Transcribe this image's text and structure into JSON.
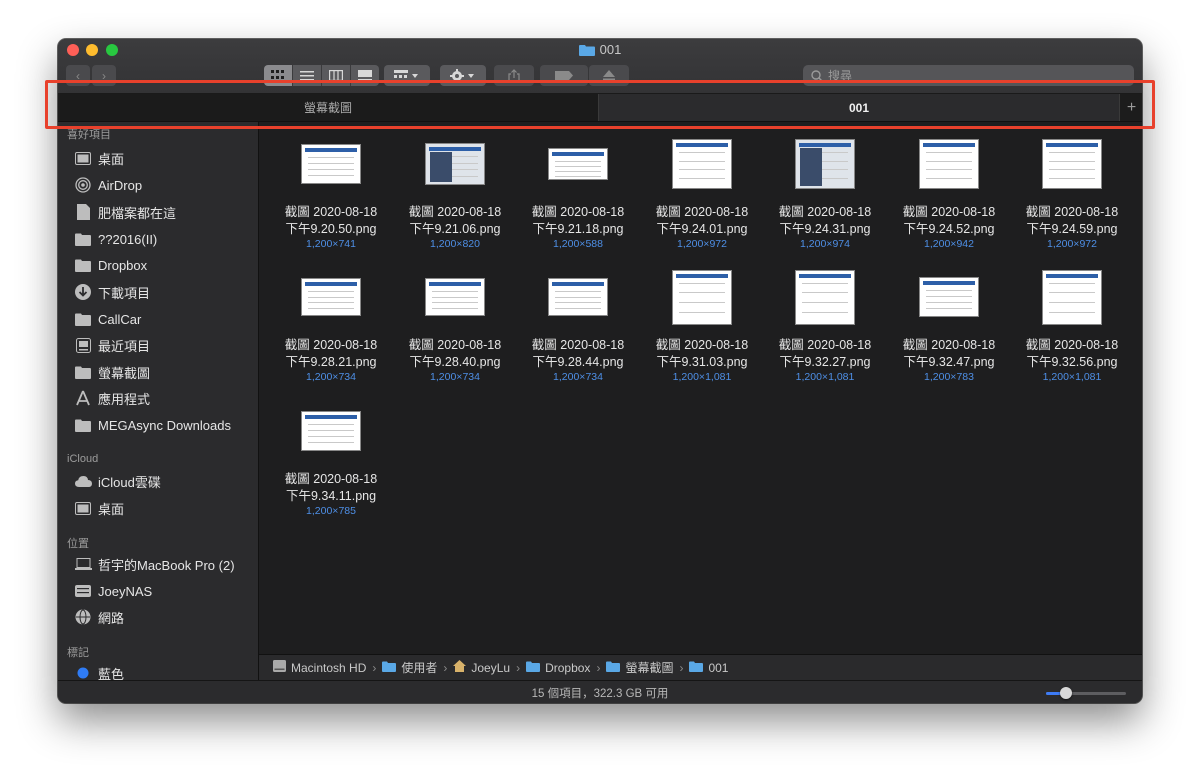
{
  "window": {
    "title": "001",
    "folder_icon": "folder-icon"
  },
  "toolbar": {
    "back_icon": "chevron-left-icon",
    "forward_icon": "chevron-right-icon",
    "view_modes": [
      "icon-view-icon",
      "list-view-icon",
      "column-view-icon",
      "gallery-view-icon"
    ],
    "active_view": "icon-view-icon",
    "search_placeholder": "搜尋"
  },
  "tabs": [
    {
      "label": "螢幕截圖",
      "active": false
    },
    {
      "label": "001",
      "active": true
    }
  ],
  "sidebar": {
    "sections": [
      {
        "header": "喜好項目",
        "items": [
          {
            "label": "桌面",
            "icon": "desktop-icon"
          },
          {
            "label": "AirDrop",
            "icon": "airdrop-icon"
          },
          {
            "label": "肥檔案都在這",
            "icon": "document-icon"
          },
          {
            "label": "??2016(II)",
            "icon": "folder-icon"
          },
          {
            "label": "Dropbox",
            "icon": "folder-icon"
          },
          {
            "label": "下載項目",
            "icon": "download-icon"
          },
          {
            "label": "CallCar",
            "icon": "folder-icon"
          },
          {
            "label": "最近項目",
            "icon": "recents-icon"
          },
          {
            "label": "螢幕截圖",
            "icon": "folder-icon"
          },
          {
            "label": "應用程式",
            "icon": "applications-icon"
          },
          {
            "label": "MEGAsync Downloads",
            "icon": "folder-icon"
          }
        ]
      },
      {
        "header": "iCloud",
        "items": [
          {
            "label": "iCloud雲碟",
            "icon": "cloud-icon"
          },
          {
            "label": "桌面",
            "icon": "desktop-icon"
          }
        ]
      },
      {
        "header": "位置",
        "items": [
          {
            "label": "哲宇的MacBook Pro (2)",
            "icon": "laptop-icon"
          },
          {
            "label": "JoeyNAS",
            "icon": "server-icon"
          },
          {
            "label": "網路",
            "icon": "network-icon"
          }
        ]
      },
      {
        "header": "標記",
        "items": [
          {
            "label": "藍色",
            "icon": "blue-tag-icon"
          }
        ]
      }
    ]
  },
  "files": [
    {
      "line1": "截圖 2020-08-18",
      "line2": "下午9.20.50.png",
      "dims": "1,200×741"
    },
    {
      "line1": "截圖 2020-08-18",
      "line2": "下午9.21.06.png",
      "dims": "1,200×820"
    },
    {
      "line1": "截圖 2020-08-18",
      "line2": "下午9.21.18.png",
      "dims": "1,200×588"
    },
    {
      "line1": "截圖 2020-08-18",
      "line2": "下午9.24.01.png",
      "dims": "1,200×972"
    },
    {
      "line1": "截圖 2020-08-18",
      "line2": "下午9.24.31.png",
      "dims": "1,200×974"
    },
    {
      "line1": "截圖 2020-08-18",
      "line2": "下午9.24.52.png",
      "dims": "1,200×942"
    },
    {
      "line1": "截圖 2020-08-18",
      "line2": "下午9.24.59.png",
      "dims": "1,200×972"
    },
    {
      "line1": "截圖 2020-08-18",
      "line2": "下午9.28.21.png",
      "dims": "1,200×734"
    },
    {
      "line1": "截圖 2020-08-18",
      "line2": "下午9.28.40.png",
      "dims": "1,200×734"
    },
    {
      "line1": "截圖 2020-08-18",
      "line2": "下午9.28.44.png",
      "dims": "1,200×734"
    },
    {
      "line1": "截圖 2020-08-18",
      "line2": "下午9.31.03.png",
      "dims": "1,200×1,081"
    },
    {
      "line1": "截圖 2020-08-18",
      "line2": "下午9.32.27.png",
      "dims": "1,200×1,081"
    },
    {
      "line1": "截圖 2020-08-18",
      "line2": "下午9.32.47.png",
      "dims": "1,200×783"
    },
    {
      "line1": "截圖 2020-08-18",
      "line2": "下午9.32.56.png",
      "dims": "1,200×1,081"
    },
    {
      "line1": "截圖 2020-08-18",
      "line2": "下午9.34.11.png",
      "dims": "1,200×785"
    }
  ],
  "path": [
    {
      "label": "Macintosh HD",
      "icon": "disk-icon"
    },
    {
      "label": "使用者",
      "icon": "folder-icon"
    },
    {
      "label": "JoeyLu",
      "icon": "home-icon"
    },
    {
      "label": "Dropbox",
      "icon": "folder-icon"
    },
    {
      "label": "螢幕截圖",
      "icon": "folder-icon"
    },
    {
      "label": "001",
      "icon": "folder-icon"
    }
  ],
  "status": {
    "text": "15 個項目，322.3 GB 可用",
    "icon_size_fraction": 0.25
  },
  "colors": {
    "highlight": "#e8412c",
    "accent": "#3d7bf5",
    "dims_text": "#4e8fe6"
  }
}
